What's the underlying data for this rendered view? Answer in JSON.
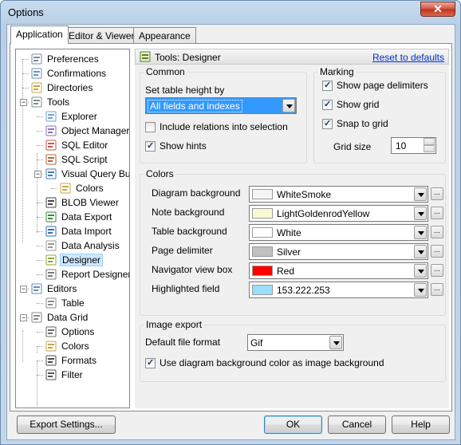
{
  "window": {
    "title": "Options",
    "close_glyph": "✕"
  },
  "tabs": [
    "Application",
    "Editor & Viewers",
    "Appearance"
  ],
  "tree": [
    {
      "label": "Preferences",
      "icon": "preferences-icon"
    },
    {
      "label": "Confirmations",
      "icon": "confirmations-icon"
    },
    {
      "label": "Directories",
      "icon": "directories-icon"
    },
    {
      "label": "Tools",
      "icon": "tools-icon"
    },
    {
      "label": "Explorer",
      "icon": "explorer-icon"
    },
    {
      "label": "Object Manager",
      "icon": "object-manager-icon"
    },
    {
      "label": "SQL Editor",
      "icon": "sql-editor-icon"
    },
    {
      "label": "SQL Script",
      "icon": "sql-script-icon"
    },
    {
      "label": "Visual Query Build",
      "icon": "visual-query-icon"
    },
    {
      "label": "Colors",
      "icon": "colors-icon"
    },
    {
      "label": "BLOB Viewer",
      "icon": "blob-viewer-icon"
    },
    {
      "label": "Data Export",
      "icon": "data-export-icon"
    },
    {
      "label": "Data Import",
      "icon": "data-import-icon"
    },
    {
      "label": "Data Analysis",
      "icon": "data-analysis-icon"
    },
    {
      "label": "Designer",
      "icon": "designer-icon"
    },
    {
      "label": "Report Designer",
      "icon": "report-designer-icon"
    },
    {
      "label": "Editors",
      "icon": "editors-icon"
    },
    {
      "label": "Table",
      "icon": "table-icon"
    },
    {
      "label": "Data Grid",
      "icon": "data-grid-icon"
    },
    {
      "label": "Options",
      "icon": "options-icon"
    },
    {
      "label": "Colors",
      "icon": "colors-icon"
    },
    {
      "label": "Formats",
      "icon": "formats-icon"
    },
    {
      "label": "Filter",
      "icon": "filter-icon"
    }
  ],
  "panel": {
    "title": "Tools: Designer",
    "reset_link": "Reset to defaults",
    "common": {
      "title": "Common",
      "table_height_label": "Set table height by",
      "table_height_value": "All fields and indexes",
      "include_relations": "Include relations into selection",
      "show_hints": "Show hints"
    },
    "marking": {
      "title": "Marking",
      "show_delimiters": "Show page delimiters",
      "show_grid": "Show grid",
      "snap_to_grid": "Snap to grid",
      "grid_size_label": "Grid size",
      "grid_size_value": "10"
    },
    "colors": {
      "title": "Colors",
      "rows": [
        {
          "label": "Diagram background",
          "value": "WhiteSmoke",
          "color": "#f5f5f5"
        },
        {
          "label": "Note background",
          "value": "LightGoldenrodYellow",
          "color": "#fafad2"
        },
        {
          "label": "Table background",
          "value": "White",
          "color": "#ffffff"
        },
        {
          "label": "Page delimiter",
          "value": "Silver",
          "color": "#c0c0c0"
        },
        {
          "label": "Navigator view box",
          "value": "Red",
          "color": "#ff0000"
        },
        {
          "label": "Highlighted field",
          "value": "153.222.253",
          "color": "#99defd"
        }
      ]
    },
    "image_export": {
      "title": "Image export",
      "format_label": "Default file format",
      "format_value": "Gif",
      "use_bg": "Use diagram background color as image background"
    }
  },
  "buttons": {
    "export": "Export Settings...",
    "ok": "OK",
    "cancel": "Cancel",
    "help": "Help"
  },
  "dots_glyph": "..."
}
